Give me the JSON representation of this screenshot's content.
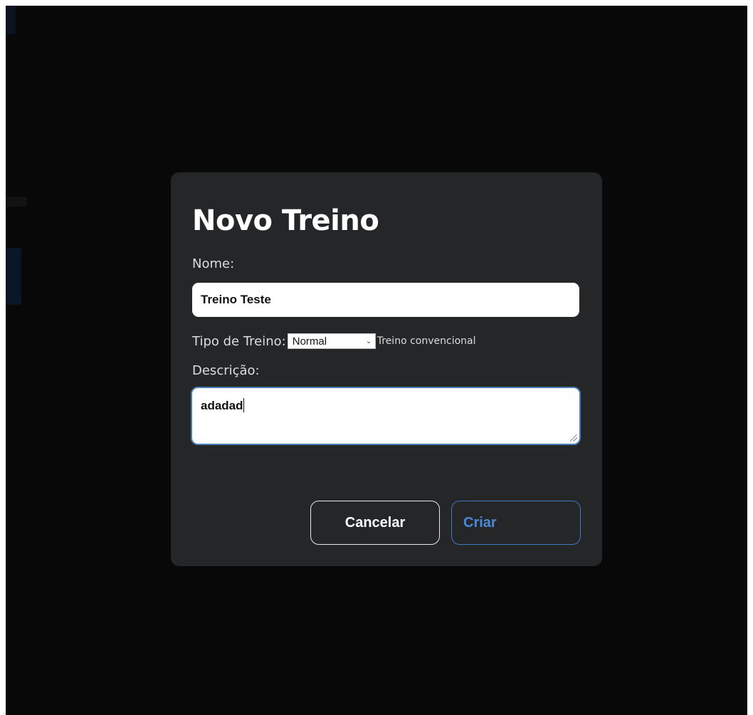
{
  "modal": {
    "title": "Novo Treino",
    "name_field": {
      "label": "Nome:",
      "value": "Treino Teste"
    },
    "type_field": {
      "label": "Tipo de Treino:",
      "selected": "Normal",
      "description": "Treino convencional"
    },
    "description_field": {
      "label": "Descrição:",
      "value": "adadad"
    },
    "buttons": {
      "cancel": "Cancelar",
      "create": "Criar"
    }
  },
  "colors": {
    "backdrop": "#080808",
    "modal_background": "#252628",
    "focus_border": "#4c7db7",
    "primary_accent": "#4c8ad9"
  },
  "icons": {
    "select_arrow": "chevron-down-icon",
    "textarea_resize": "resize-grip-icon"
  }
}
